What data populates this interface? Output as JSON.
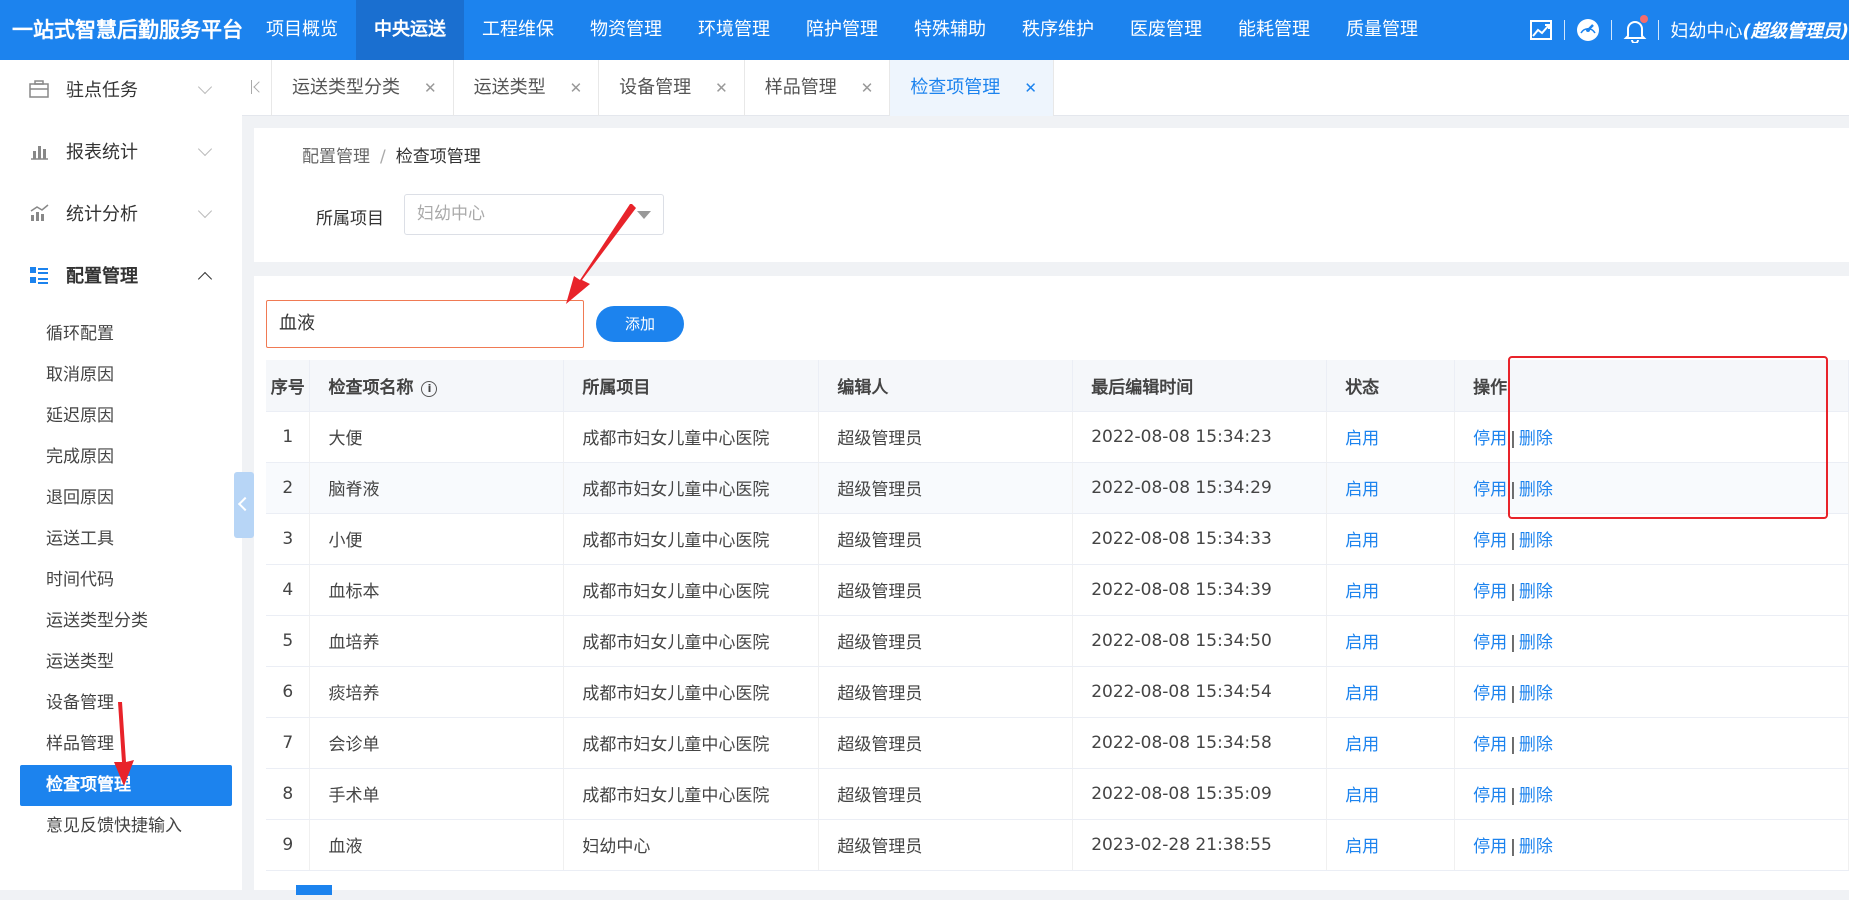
{
  "topbar": {
    "brand": "一站式智慧后勤服务平台",
    "nav": [
      "项目概览",
      "中央运送",
      "工程维保",
      "物资管理",
      "环境管理",
      "陪护管理",
      "特殊辅助",
      "秩序维护",
      "医废管理",
      "能耗管理",
      "质量管理"
    ],
    "active_index": 1,
    "user_name": "妇幼中心",
    "user_role": "(超级管理员)",
    "icons": [
      "trend-chart-icon",
      "dashboard-gauge-icon",
      "bell-icon"
    ]
  },
  "sidebar": {
    "groups": [
      {
        "label": "驻点任务",
        "icon": "briefcase-icon"
      },
      {
        "label": "报表统计",
        "icon": "bar-chart-icon"
      },
      {
        "label": "统计分析",
        "icon": "analysis-chart-icon"
      },
      {
        "label": "配置管理",
        "icon": "config-list-icon"
      }
    ],
    "subitems": [
      "循环配置",
      "取消原因",
      "延迟原因",
      "完成原因",
      "退回原因",
      "运送工具",
      "时间代码",
      "运送类型分类",
      "运送类型",
      "设备管理",
      "样品管理",
      "检查项管理",
      "意见反馈快捷输入"
    ],
    "active_sub": "检查项管理"
  },
  "tabs": [
    {
      "label": "运送类型分类"
    },
    {
      "label": "运送类型"
    },
    {
      "label": "设备管理"
    },
    {
      "label": "样品管理"
    },
    {
      "label": "检查项管理",
      "active": true
    }
  ],
  "breadcrumb": {
    "parent": "配置管理",
    "current": "检查项管理"
  },
  "filter": {
    "label": "所属项目",
    "value": "妇幼中心"
  },
  "search": {
    "value": "血液"
  },
  "add_button": "添加",
  "table": {
    "headers": [
      "序号",
      "检查项名称",
      "所属项目",
      "编辑人",
      "最后编辑时间",
      "状态",
      "操作"
    ],
    "action_disable": "停用",
    "action_delete": "删除",
    "rows": [
      {
        "no": "1",
        "name": "大便",
        "project": "成都市妇女儿童中心医院",
        "editor": "超级管理员",
        "time": "2022-08-08 15:34:23",
        "status": "启用"
      },
      {
        "no": "2",
        "name": "脑脊液",
        "project": "成都市妇女儿童中心医院",
        "editor": "超级管理员",
        "time": "2022-08-08 15:34:29",
        "status": "启用"
      },
      {
        "no": "3",
        "name": "小便",
        "project": "成都市妇女儿童中心医院",
        "editor": "超级管理员",
        "time": "2022-08-08 15:34:33",
        "status": "启用"
      },
      {
        "no": "4",
        "name": "血标本",
        "project": "成都市妇女儿童中心医院",
        "editor": "超级管理员",
        "time": "2022-08-08 15:34:39",
        "status": "启用"
      },
      {
        "no": "5",
        "name": "血培养",
        "project": "成都市妇女儿童中心医院",
        "editor": "超级管理员",
        "time": "2022-08-08 15:34:50",
        "status": "启用"
      },
      {
        "no": "6",
        "name": "痰培养",
        "project": "成都市妇女儿童中心医院",
        "editor": "超级管理员",
        "time": "2022-08-08 15:34:54",
        "status": "启用"
      },
      {
        "no": "7",
        "name": "会诊单",
        "project": "成都市妇女儿童中心医院",
        "editor": "超级管理员",
        "time": "2022-08-08 15:34:58",
        "status": "启用"
      },
      {
        "no": "8",
        "name": "手术单",
        "project": "成都市妇女儿童中心医院",
        "editor": "超级管理员",
        "time": "2022-08-08 15:35:09",
        "status": "启用"
      },
      {
        "no": "9",
        "name": "血液",
        "project": "妇幼中心",
        "editor": "超级管理员",
        "time": "2023-02-28 21:38:55",
        "status": "启用"
      }
    ]
  },
  "colors": {
    "primary": "#1c83ee",
    "annotation_red": "#e8232a"
  }
}
